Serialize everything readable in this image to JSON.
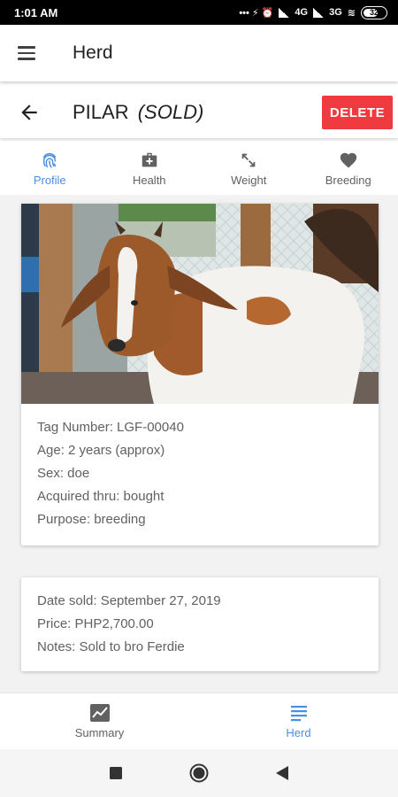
{
  "status_bar": {
    "time": "1:01 AM",
    "icons": "... ⚡ ⏰ 4G 3G",
    "network_4g": "4G",
    "network_3g": "3G",
    "battery": "32"
  },
  "app_bar": {
    "title": "Herd",
    "menu_icon": "hamburger-menu-icon"
  },
  "animal": {
    "name": "PILAR",
    "status": "(SOLD)",
    "delete_label": "DELETE",
    "delete_color": "#ef3b3f"
  },
  "tabs": [
    {
      "label": "Profile",
      "icon": "fingerprint-icon",
      "active": true
    },
    {
      "label": "Health",
      "icon": "medical-kit-icon",
      "active": false
    },
    {
      "label": "Weight",
      "icon": "resize-arrows-icon",
      "active": false
    },
    {
      "label": "Breeding",
      "icon": "heart-icon",
      "active": false
    }
  ],
  "profile": {
    "tag_number": "Tag Number: LGF-00040",
    "age": "Age: 2 years (approx)",
    "sex": "Sex: doe",
    "acquired": "Acquired thru: bought",
    "purpose": "Purpose: breeding"
  },
  "sale": {
    "date_sold": "Date sold: September 27, 2019",
    "price": "Price: PHP2,700.00",
    "notes": "Notes: Sold to bro Ferdie"
  },
  "bottom_nav": [
    {
      "label": "Summary",
      "icon": "chart-icon",
      "active": false
    },
    {
      "label": "Herd",
      "icon": "list-icon",
      "active": true
    }
  ],
  "colors": {
    "accent": "#4a90e2",
    "background": "#f2f2f2"
  }
}
